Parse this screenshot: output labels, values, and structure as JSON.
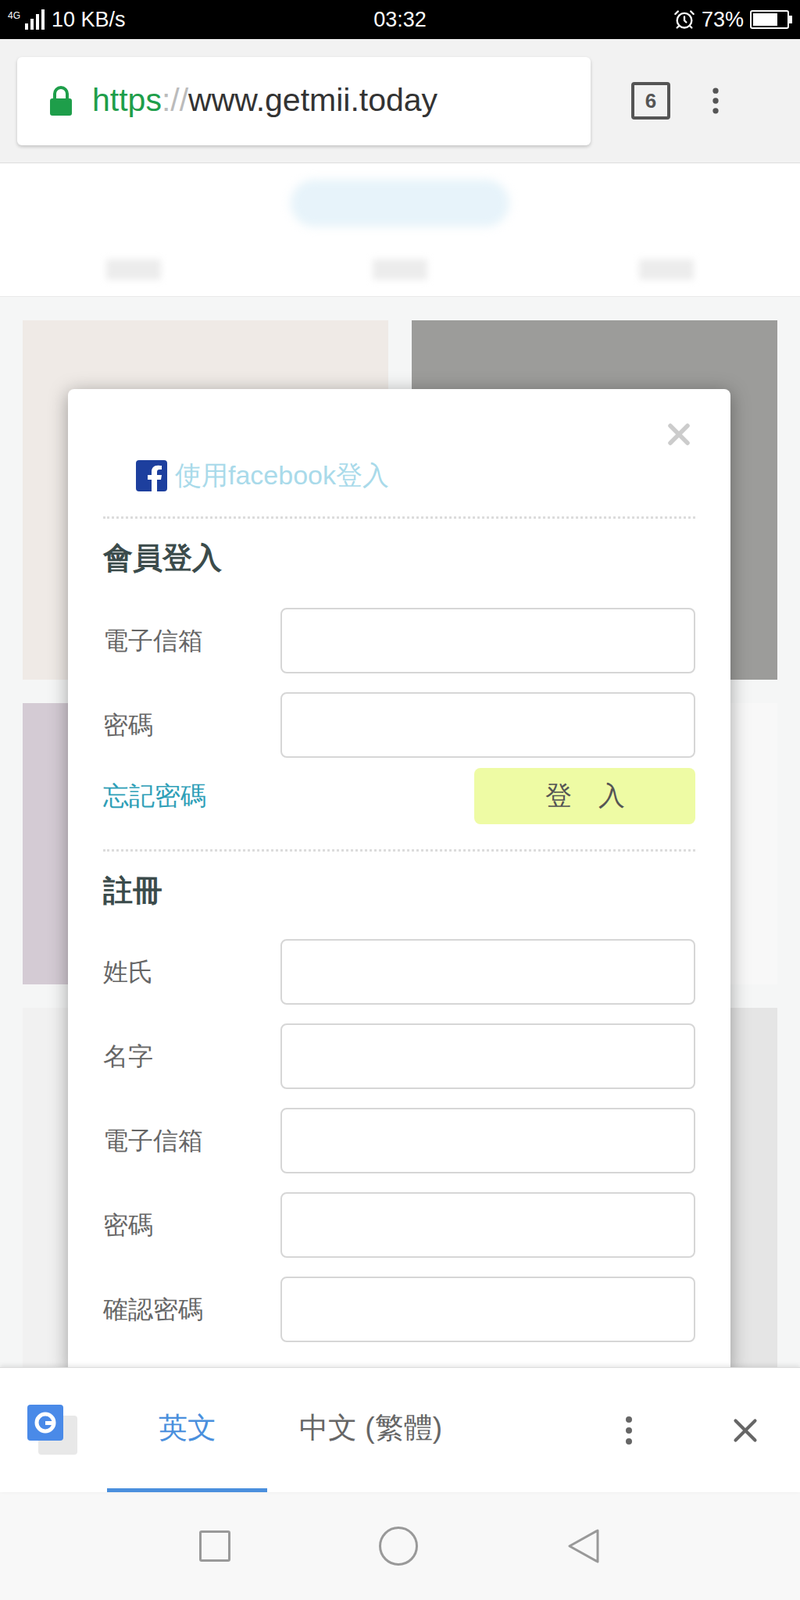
{
  "status_bar": {
    "network": "4G",
    "speed": "10 KB/s",
    "time": "03:32",
    "battery": "73%",
    "battery_level": 0.73
  },
  "browser": {
    "secure": true,
    "url_scheme": "https",
    "url_separator": "://",
    "url_host": "www.getmii.today",
    "tab_count": "6"
  },
  "modal": {
    "facebook_login": "使用facebook登入",
    "login": {
      "title": "會員登入",
      "fields": [
        {
          "label": "電子信箱"
        },
        {
          "label": "密碼"
        }
      ],
      "forgot": "忘記密碼",
      "submit": "登　入"
    },
    "register": {
      "title": "註冊",
      "fields": [
        {
          "label": "姓氏"
        },
        {
          "label": "名字"
        },
        {
          "label": "電子信箱"
        },
        {
          "label": "密碼"
        },
        {
          "label": "確認密碼"
        }
      ]
    }
  },
  "translate_bar": {
    "languages": [
      {
        "label": "英文",
        "selected": true
      },
      {
        "label": "中文 (繁體)",
        "selected": false
      }
    ]
  }
}
